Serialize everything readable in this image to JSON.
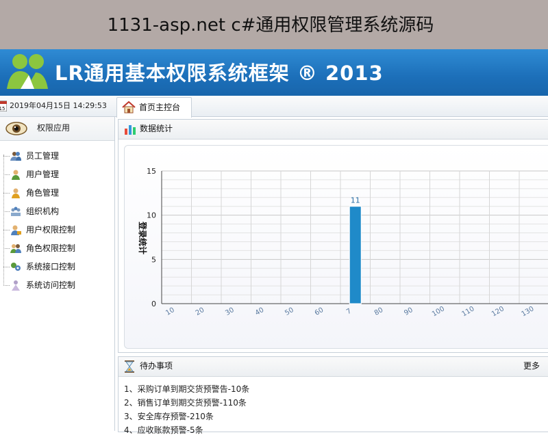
{
  "banner": {
    "title": "1131-asp.net c#通用权限管理系统源码"
  },
  "header": {
    "app_title": "LR通用基本权限系统框架 ® 2013",
    "accent": "#1c6fb9"
  },
  "topbar": {
    "calendar_icon": "calendar-icon",
    "datetime": "2019年04月15日 14:29:53"
  },
  "tabs": [
    {
      "label": "首页主控台",
      "icon": "home-icon",
      "active": true
    }
  ],
  "sidebar": {
    "header": "权限应用",
    "header_icon": "eye-icon",
    "items": [
      {
        "label": "员工管理",
        "icon": "employees-icon"
      },
      {
        "label": "用户管理",
        "icon": "user-icon"
      },
      {
        "label": "角色管理",
        "icon": "role-icon"
      },
      {
        "label": "组织机构",
        "icon": "organization-icon"
      },
      {
        "label": "用户权限控制",
        "icon": "user-permission-icon"
      },
      {
        "label": "角色权限控制",
        "icon": "role-permission-icon"
      },
      {
        "label": "系统接口控制",
        "icon": "interface-icon"
      },
      {
        "label": "系统访问控制",
        "icon": "access-icon"
      }
    ]
  },
  "stats": {
    "title": "数据统计",
    "icon": "bar-chart-icon"
  },
  "chart_data": {
    "type": "bar",
    "ylabel": "登录统计",
    "xlabel": "",
    "categories": [
      "10",
      "20",
      "30",
      "40",
      "50",
      "60",
      "7",
      "80",
      "90",
      "100",
      "110",
      "120",
      "130"
    ],
    "values": [
      0,
      0,
      0,
      0,
      0,
      0,
      11,
      0,
      0,
      0,
      0,
      0,
      0
    ],
    "data_labels": [
      "",
      "",
      "",
      "",
      "",
      "",
      "11",
      "",
      "",
      "",
      "",
      "",
      ""
    ],
    "ylim": [
      0,
      15
    ],
    "yticks": [
      0,
      5,
      10,
      15
    ],
    "grid": true,
    "bar_color": "#1f8ac9"
  },
  "todo": {
    "title": "待办事项",
    "icon": "hourglass-icon",
    "more": "更多",
    "items": [
      "1、采购订单到期交货预警告-10条",
      "2、销售订单到期交货预警-110条",
      "3、安全库存预警-210条",
      "4、应收账款预警-5条"
    ]
  }
}
